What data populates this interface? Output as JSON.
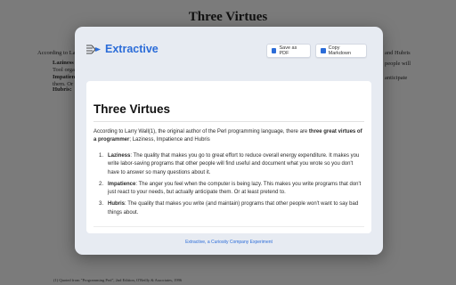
{
  "background": {
    "title": "Three Virtues",
    "left_fragments": [
      "According to La",
      "Laziness",
      "Tool orga",
      "Impatienc",
      "them. Or",
      "Hubris:"
    ],
    "right_fragments": [
      "and Hubris",
      "people will",
      "anticipate"
    ],
    "footnote": "(1) Quoted from \"Programming Perl\", 2nd Edition, O'Reilly & Associates, 1996"
  },
  "header": {
    "brand": "Extractive",
    "save_pdf_label": "Save as PDF",
    "copy_markdown_label": "Copy Markdown"
  },
  "article": {
    "title": "Three Virtues",
    "intro_prefix": "According to Larry Wall(1), the original author of the Perl programming language, there are ",
    "intro_bold": "three great virtues of a programmer",
    "intro_suffix": "; Laziness, Impatience and Hubris",
    "items": [
      {
        "num": "1.",
        "term": "Laziness",
        "text": ": The quality that makes you go to great effort to reduce overall energy expenditure. It makes you write labor-saving programs that other people will find useful and document what you wrote so you don't have to answer so many questions about it."
      },
      {
        "num": "2.",
        "term": "Impatience",
        "text": ": The anger you feel when the computer is being lazy. This makes you write programs that don't just react to your needs, but actually anticipate them. Or at least pretend to."
      },
      {
        "num": "3.",
        "term": "Hubris",
        "text": ": The quality that makes you write (and maintain) programs that other people won't want to say bad things about."
      }
    ]
  },
  "footer": {
    "credit": "Extractive, a Curiosity Company Experiment"
  }
}
